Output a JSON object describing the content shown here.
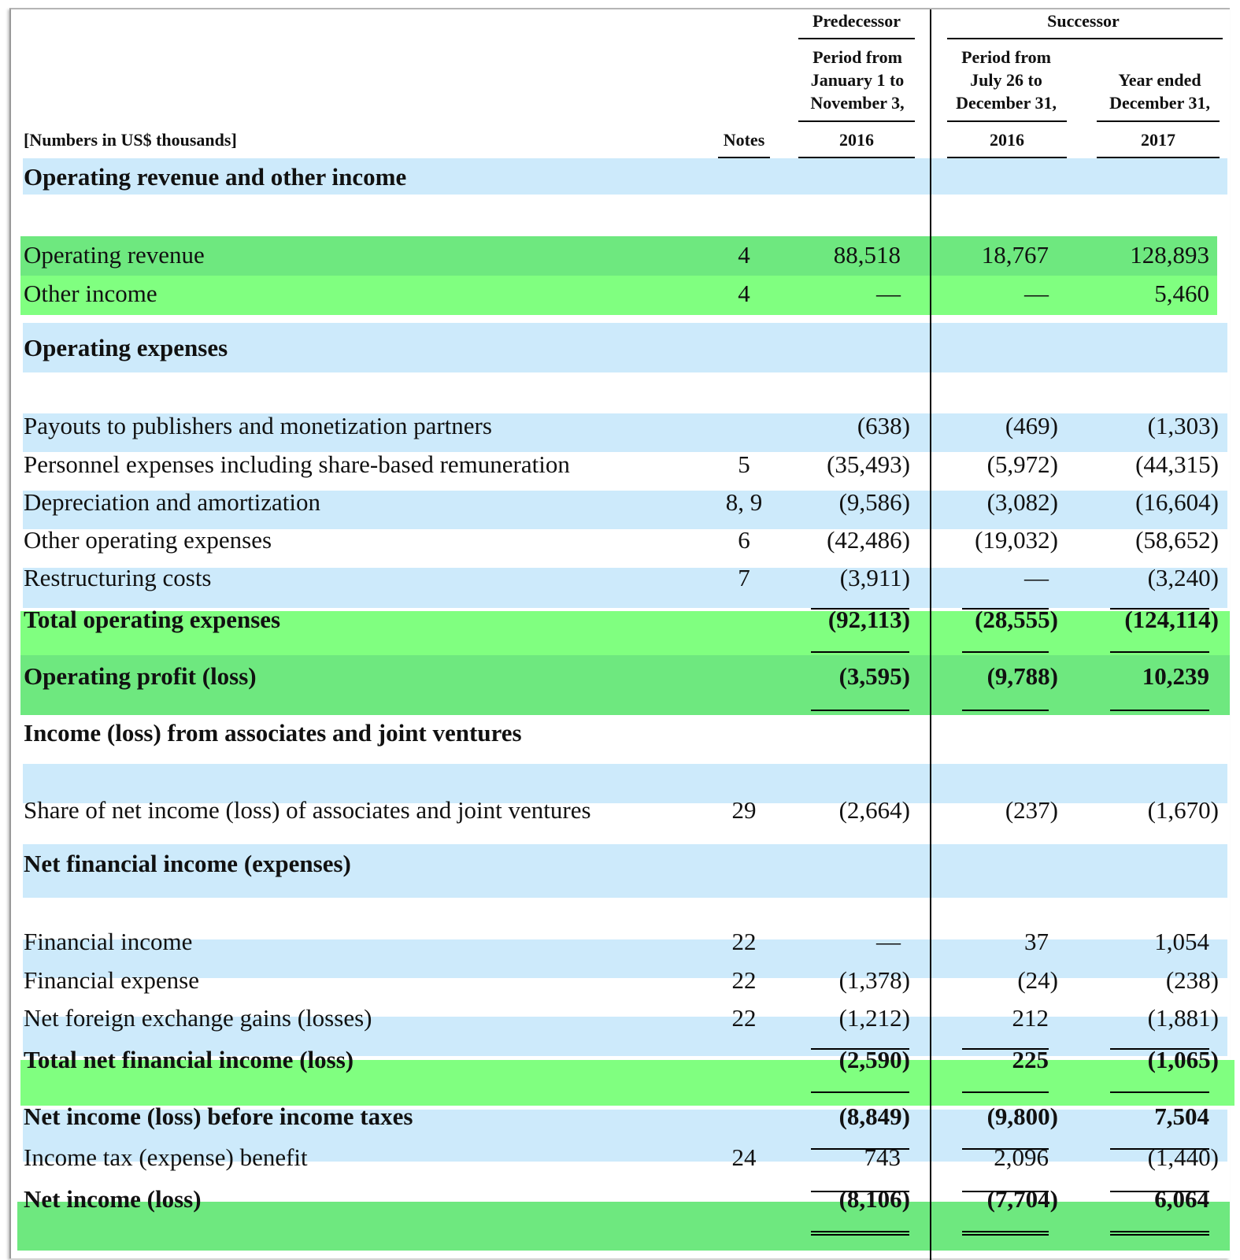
{
  "header": {
    "units_label": "[Numbers in US$ thousands]",
    "notes_label": "Notes",
    "predecessor_label": "Predecessor",
    "successor_label": "Successor",
    "col1_line1": "Period from",
    "col1_line2": "January 1 to",
    "col1_line3": "November 3,",
    "col1_year": "2016",
    "col2_line1": "Period from",
    "col2_line2": "July 26 to",
    "col2_line3": "December 31,",
    "col2_year": "2016",
    "col3_line1": "Year ended",
    "col3_line2": "December 31,",
    "col3_year": "2017"
  },
  "colors": {
    "blue_band": "#cdeafb",
    "green_band": "#6ee87f",
    "green_band_light": "#80ff80"
  },
  "sections": {
    "operating_revenue_header": "Operating revenue and other income",
    "operating_expenses_header": "Operating expenses",
    "associates_header": "Income (loss) from associates and joint ventures",
    "financial_header": "Net financial income (expenses)"
  },
  "rows": {
    "operating_revenue": {
      "label": "Operating revenue",
      "note": "4",
      "c1": "88,518",
      "c2": "18,767",
      "c3": "128,893"
    },
    "other_income": {
      "label": "Other income",
      "note": "4",
      "c1": "—",
      "c2": "—",
      "c3": "5,460"
    },
    "payouts": {
      "label": "Payouts to publishers and monetization partners",
      "note": "",
      "c1": "(638)",
      "c2": "(469)",
      "c3": "(1,303)"
    },
    "personnel": {
      "label": "Personnel expenses including share-based remuneration",
      "note": "5",
      "c1": "(35,493)",
      "c2": "(5,972)",
      "c3": "(44,315)"
    },
    "depreciation": {
      "label": "Depreciation and amortization",
      "note": "8, 9",
      "c1": "(9,586)",
      "c2": "(3,082)",
      "c3": "(16,604)"
    },
    "other_opex": {
      "label": "Other operating expenses",
      "note": "6",
      "c1": "(42,486)",
      "c2": "(19,032)",
      "c3": "(58,652)"
    },
    "restructuring": {
      "label": "Restructuring costs",
      "note": "7",
      "c1": "(3,911)",
      "c2": "—",
      "c3": "(3,240)"
    },
    "total_opex": {
      "label": "Total operating expenses",
      "note": "",
      "c1": "(92,113)",
      "c2": "(28,555)",
      "c3": "(124,114)"
    },
    "operating_profit": {
      "label": "Operating profit (loss)",
      "note": "",
      "c1": "(3,595)",
      "c2": "(9,788)",
      "c3": "10,239"
    },
    "share_associates": {
      "label": "Share of net income (loss) of associates and joint ventures",
      "note": "29",
      "c1": "(2,664)",
      "c2": "(237)",
      "c3": "(1,670)"
    },
    "financial_income": {
      "label": "Financial income",
      "note": "22",
      "c1": "—",
      "c2": "37",
      "c3": "1,054"
    },
    "financial_expense": {
      "label": "Financial expense",
      "note": "22",
      "c1": "(1,378)",
      "c2": "(24)",
      "c3": "(238)"
    },
    "fx": {
      "label": "Net foreign exchange gains (losses)",
      "note": "22",
      "c1": "(1,212)",
      "c2": "212",
      "c3": "(1,881)"
    },
    "total_financial": {
      "label": "Total net financial income (loss)",
      "note": "",
      "c1": "(2,590)",
      "c2": "225",
      "c3": "(1,065)"
    },
    "before_tax": {
      "label": "Net income (loss) before income taxes",
      "note": "",
      "c1": "(8,849)",
      "c2": "(9,800)",
      "c3": "7,504"
    },
    "income_tax": {
      "label": "Income tax (expense) benefit",
      "note": "24",
      "c1": "743",
      "c2": "2,096",
      "c3": "(1,440)"
    },
    "net_income": {
      "label": "Net income (loss)",
      "note": "",
      "c1": "(8,106)",
      "c2": "(7,704)",
      "c3": "6,064"
    }
  }
}
